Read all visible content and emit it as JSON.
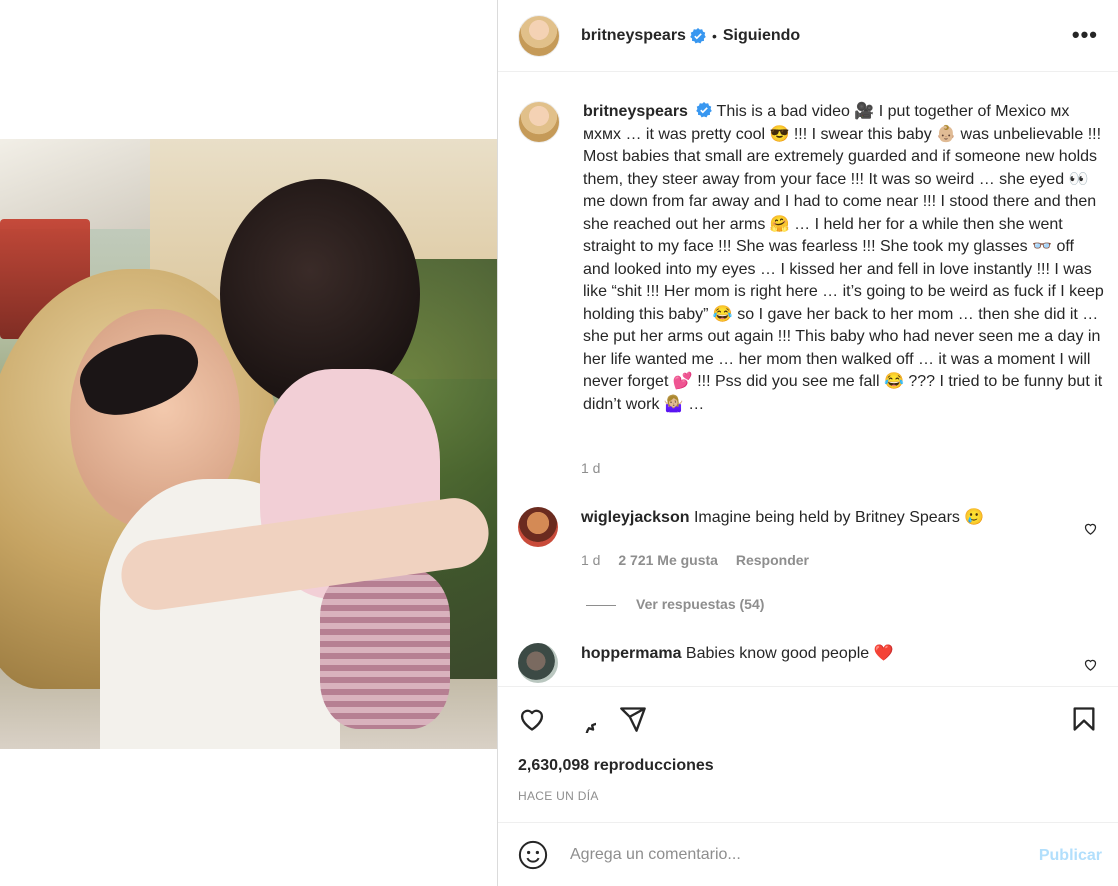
{
  "post": {
    "username": "britneyspears",
    "follow_status": "Siguiendo",
    "dot": "•",
    "more": "•••",
    "caption": "This is a bad video 🎥 I put together of Mexico ᴍx ᴍxᴍx … it was pretty cool 😎 !!! I swear this baby 👶🏼 was unbelievable !!! Most babies that small are extremely guarded and if someone new holds them, they steer away from your face !!! It was so weird … she eyed 👀 me down from far away and I had to come near !!! I stood there and then she reached out her arms 🤗 … I held her for a while then she went straight to my face !!! She was fearless !!! She took my glasses 👓 off and looked into my eyes … I kissed her and fell in love instantly !!! I was like “shit !!! Her mom is right here … it’s going to be weird as fuck if I keep holding this baby” 😂 so I gave her back to her mom … then she did it … she put her arms out again !!! This baby who had never seen me a day in her life wanted me … her mom then walked off … it was a moment I will never forget 💕 !!! Pss did you see me fall 😂 ??? I tried to be funny but it didn’t work 🤷🏼‍♀️ …",
    "caption_time": "1 d"
  },
  "comments": [
    {
      "username": "wigleyjackson",
      "text": "Imagine being held by Britney Spears 🥲",
      "time": "1 d",
      "likes": "2 721 Me gusta",
      "reply": "Responder",
      "view_replies": "Ver respuestas (54)"
    },
    {
      "username": "hoppermama",
      "text": "Babies know good people ❤️"
    }
  ],
  "stats": {
    "views": "2,630,098 reproducciones",
    "ago": "HACE UN DÍA"
  },
  "composer": {
    "placeholder": "Agrega un comentario...",
    "publish": "Publicar"
  },
  "colors": {
    "verified": "#3897f0",
    "heart_red": "#ed4956",
    "publish_disabled": "#b2dffc"
  },
  "icons": [
    "heart-icon",
    "comment-icon",
    "share-icon",
    "bookmark-icon",
    "emoji-icon",
    "verified-icon",
    "more-icon"
  ]
}
